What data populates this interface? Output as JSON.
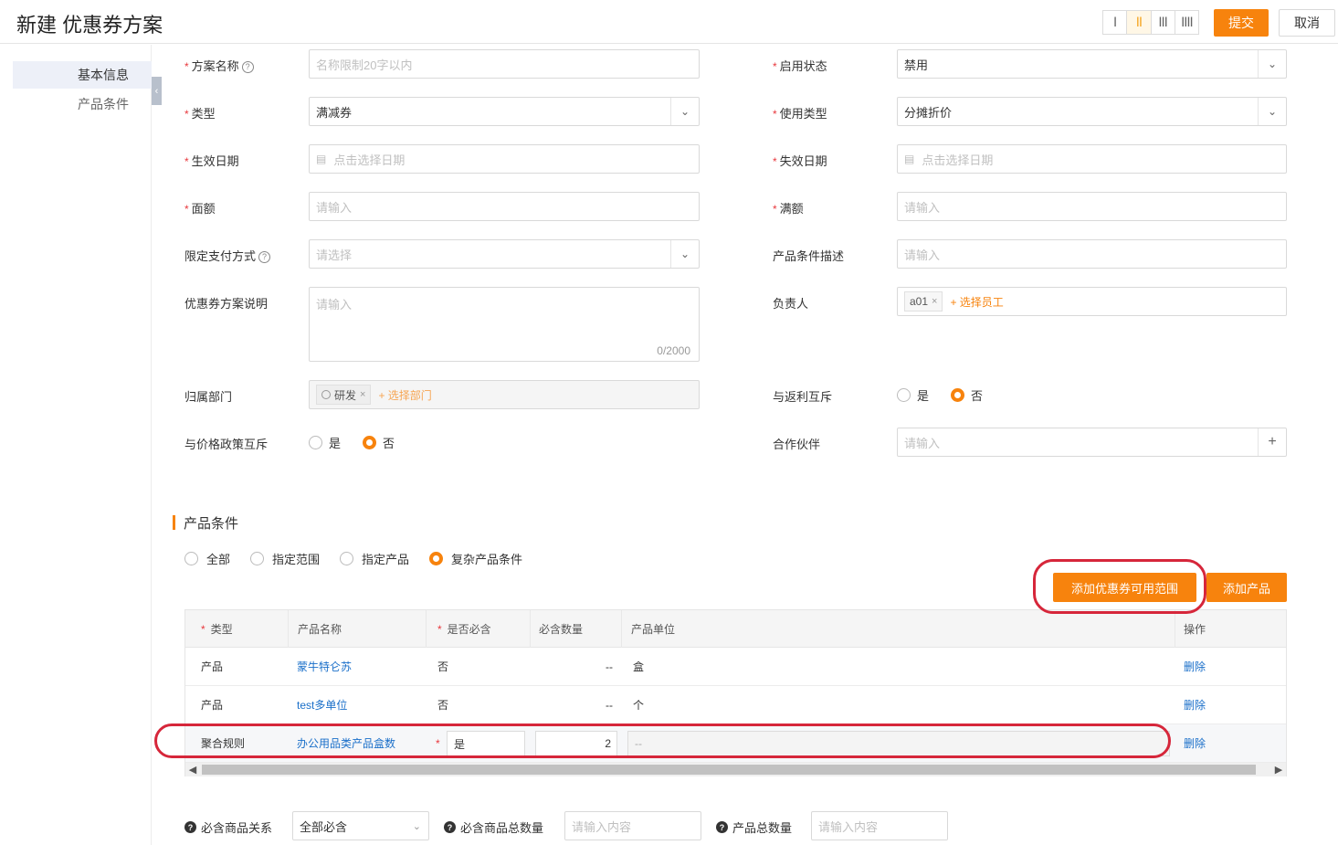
{
  "header": {
    "title": "新建 优惠券方案",
    "layout_options": [
      "I",
      "II",
      "III",
      "IIII"
    ],
    "submit_label": "提交",
    "cancel_label": "取消"
  },
  "sidebar": {
    "items": [
      {
        "label": "基本信息",
        "active": true
      },
      {
        "label": "产品条件",
        "active": false
      }
    ],
    "collapse_icon": "chevron-left-icon"
  },
  "form": {
    "scheme_name": {
      "label": "方案名称",
      "placeholder": "名称限制20字以内",
      "required": true
    },
    "enable_status": {
      "label": "启用状态",
      "value": "禁用",
      "required": true
    },
    "type": {
      "label": "类型",
      "value": "满减券",
      "required": true
    },
    "usage_type": {
      "label": "使用类型",
      "value": "分摊折价",
      "required": true
    },
    "effective_date": {
      "label": "生效日期",
      "placeholder": "点击选择日期",
      "required": true
    },
    "expiry_date": {
      "label": "失效日期",
      "placeholder": "点击选择日期",
      "required": true
    },
    "face_value": {
      "label": "面额",
      "placeholder": "请输入",
      "required": true
    },
    "threshold": {
      "label": "满额",
      "placeholder": "请输入",
      "required": true
    },
    "payment_method": {
      "label": "限定支付方式",
      "placeholder": "请选择"
    },
    "product_desc": {
      "label": "产品条件描述",
      "placeholder": "请输入"
    },
    "scheme_desc": {
      "label": "优惠券方案说明",
      "placeholder": "请输入",
      "counter": "0/2000"
    },
    "owner": {
      "label": "负责人",
      "tag": "a01",
      "add_label": "+ 选择员工"
    },
    "department": {
      "label": "归属部门",
      "tag": "研发",
      "add_label": "+ 选择部门"
    },
    "rebate_exclusive": {
      "label": "与返利互斥",
      "options": [
        "是",
        "否"
      ],
      "selected": "否"
    },
    "price_policy_exclusive": {
      "label": "与价格政策互斥",
      "options": [
        "是",
        "否"
      ],
      "selected": "否"
    },
    "partner": {
      "label": "合作伙伴",
      "placeholder": "请输入",
      "add_icon": "+"
    }
  },
  "product_section": {
    "title": "产品条件",
    "scope_options": [
      "全部",
      "指定范围",
      "指定产品",
      "复杂产品条件"
    ],
    "scope_selected": "复杂产品条件",
    "add_scope_label": "添加优惠券可用范围",
    "add_product_label": "添加产品",
    "columns": [
      "类型",
      "产品名称",
      "是否必含",
      "必含数量",
      "产品单位",
      "操作"
    ],
    "rows": [
      {
        "type": "产品",
        "name": "蒙牛特仑苏",
        "required": "否",
        "qty": "--",
        "unit": "盒",
        "action": "删除"
      },
      {
        "type": "产品",
        "name": "test多单位",
        "required": "否",
        "qty": "--",
        "unit": "个",
        "action": "删除"
      },
      {
        "type": "聚合规则",
        "name": "办公用品类产品盒数",
        "required": "是",
        "qty": "2",
        "unit": "--",
        "action": "删除"
      }
    ]
  },
  "bottom": {
    "relation_label": "必含商品关系",
    "relation_value": "全部必含",
    "total_required_label": "必含商品总数量",
    "total_required_placeholder": "请输入内容",
    "total_products_label": "产品总数量",
    "total_products_placeholder": "请输入内容"
  },
  "colors": {
    "accent": "#f7830d",
    "link": "#1a6fc9",
    "annotation": "#d6263a"
  }
}
